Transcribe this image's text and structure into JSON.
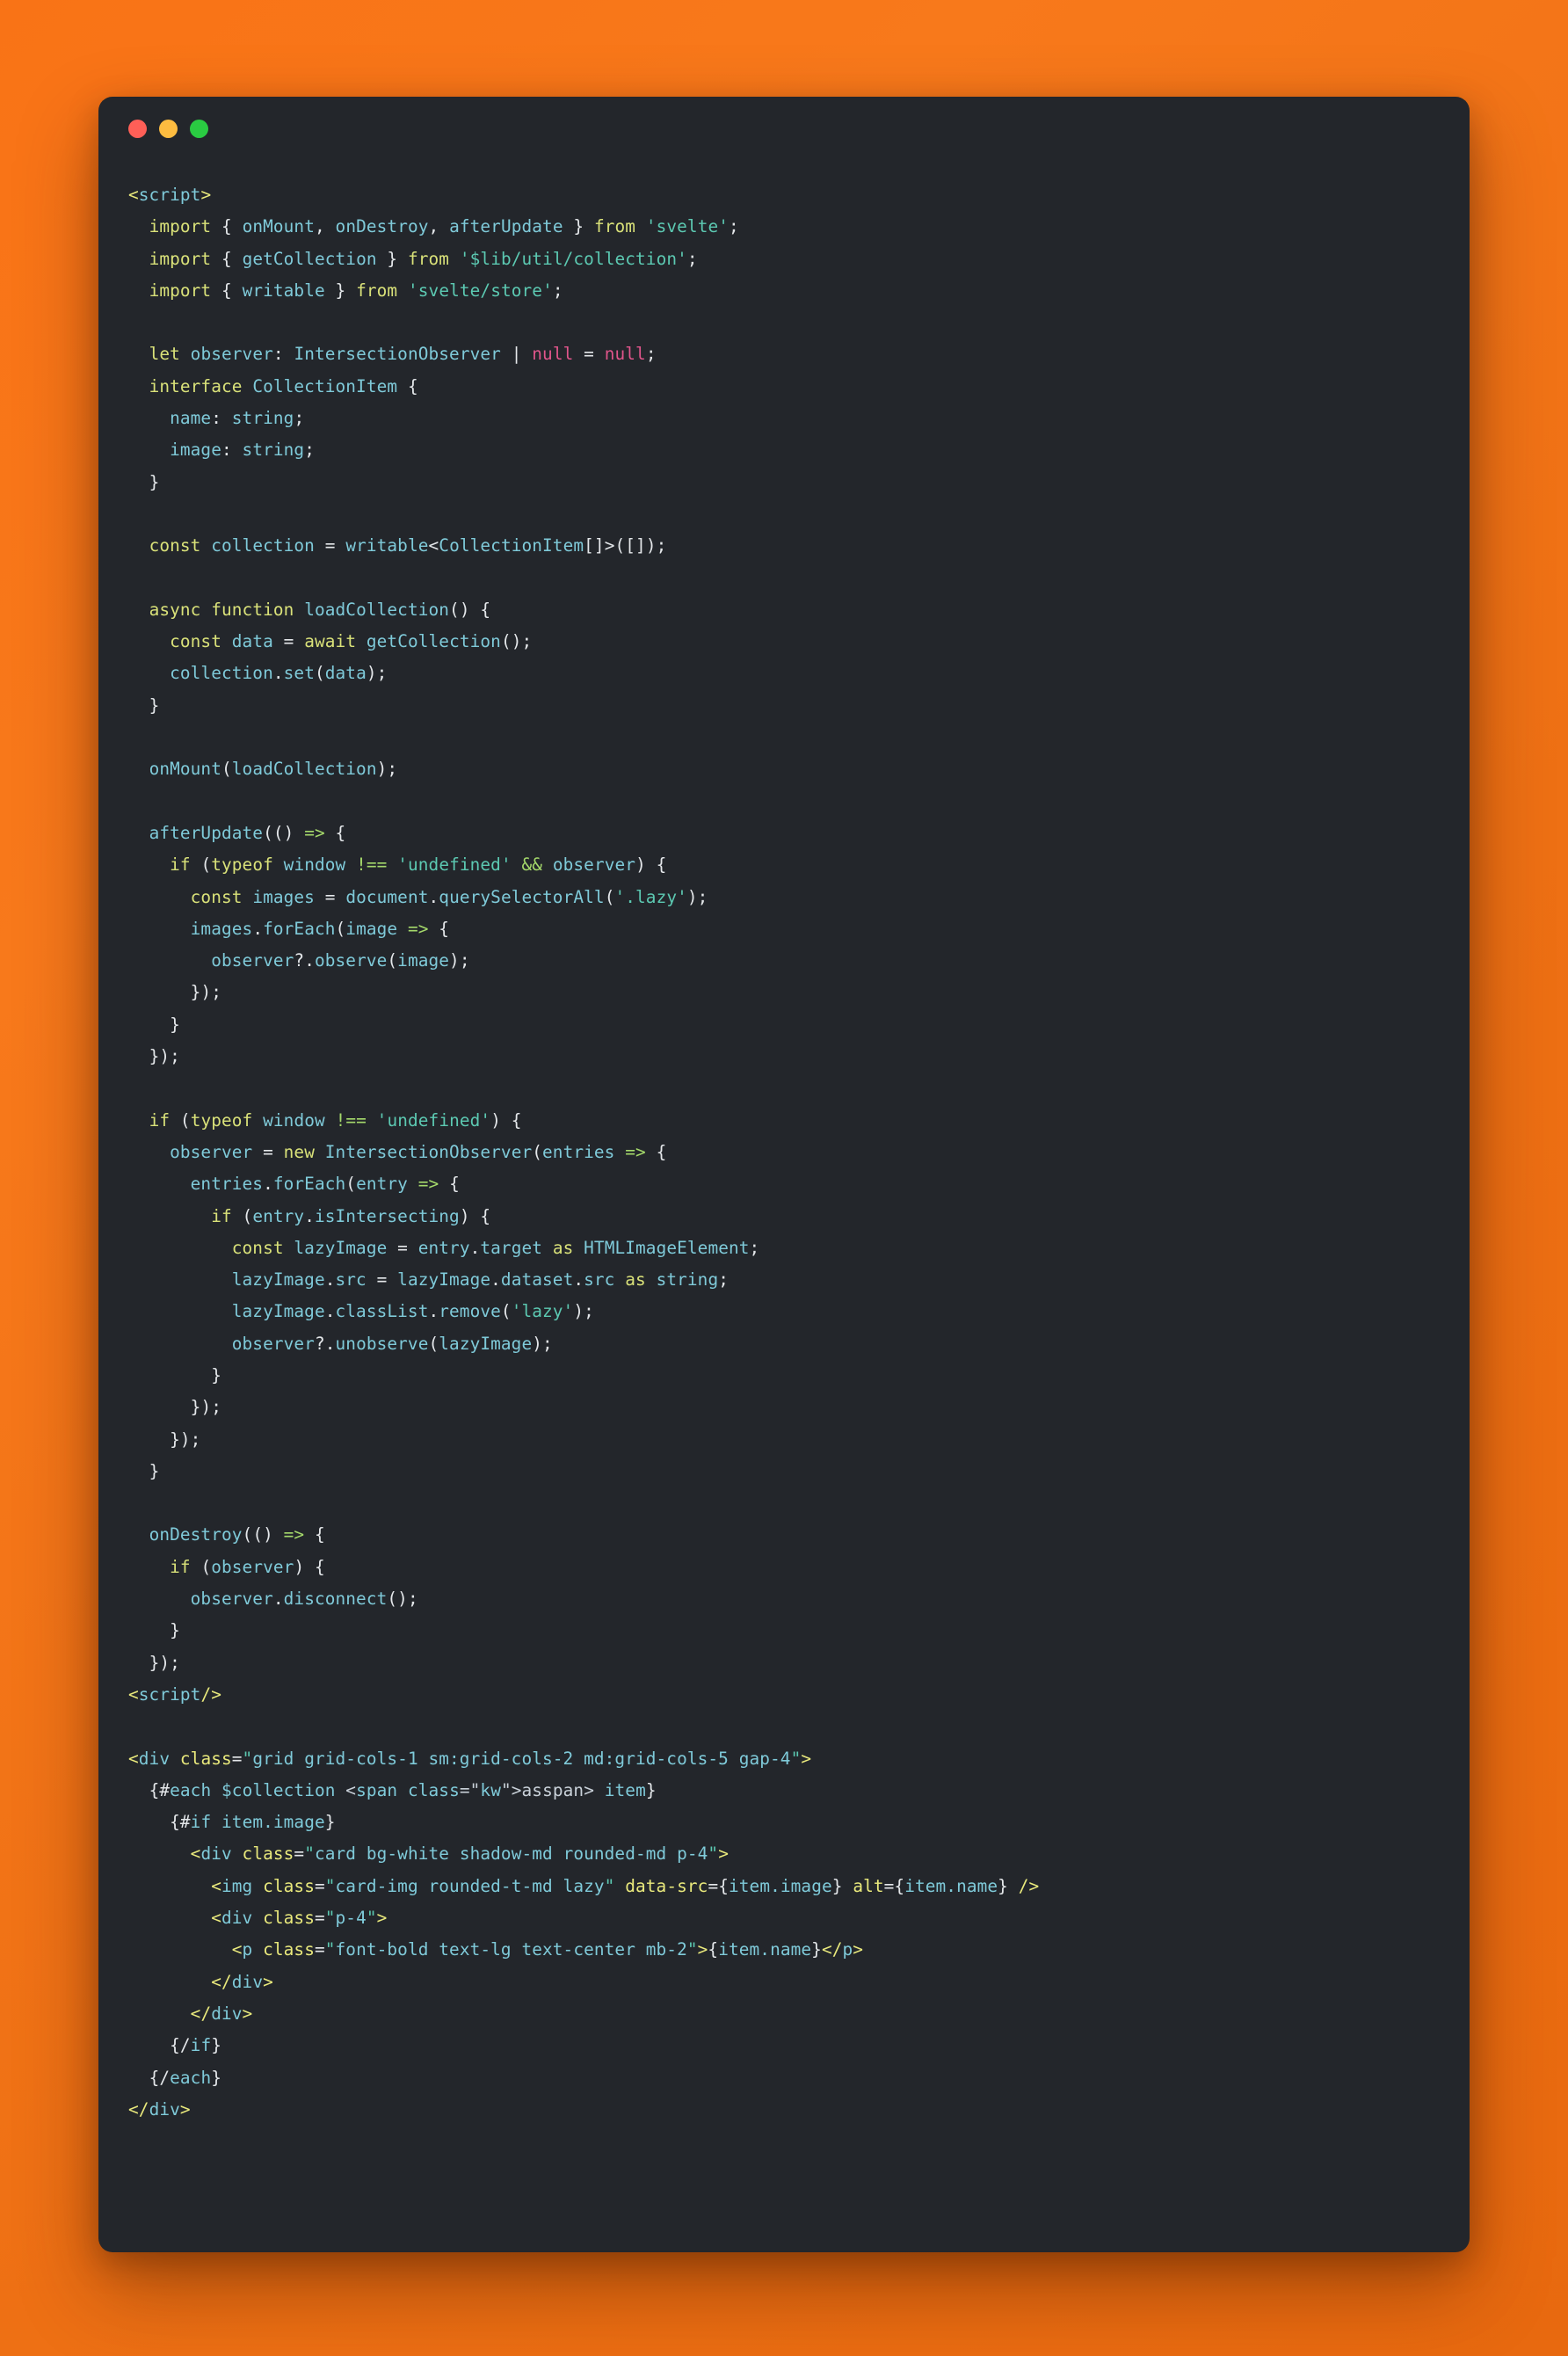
{
  "window": {
    "background_color": "#F97316",
    "panel_color": "#23262B",
    "traffic_lights": [
      {
        "name": "close",
        "color": "#FF5F57"
      },
      {
        "name": "minimize",
        "color": "#FDBC40"
      },
      {
        "name": "maximize",
        "color": "#2ACB42"
      }
    ]
  },
  "theme": {
    "keyword": "#D9E179",
    "identifier": "#7FCAD9",
    "string": "#5CC9B2",
    "tag": "#E9E97C",
    "punctuation": "#E4E7EA",
    "null_literal": "#E0558B",
    "operator": "#A5D96B"
  },
  "code": {
    "language": "svelte",
    "lines": [
      "<script>",
      "  import { onMount, onDestroy, afterUpdate } from 'svelte';",
      "  import { getCollection } from '$lib/util/collection';",
      "  import { writable } from 'svelte/store';",
      "",
      "  let observer: IntersectionObserver | null = null;",
      "  interface CollectionItem {",
      "    name: string;",
      "    image: string;",
      "  }",
      "",
      "  const collection = writable<CollectionItem[]>([]);",
      "",
      "  async function loadCollection() {",
      "    const data = await getCollection();",
      "    collection.set(data);",
      "  }",
      "",
      "  onMount(loadCollection);",
      "",
      "  afterUpdate(() => {",
      "    if (typeof window !== 'undefined' && observer) {",
      "      const images = document.querySelectorAll('.lazy');",
      "      images.forEach(image => {",
      "        observer?.observe(image);",
      "      });",
      "    }",
      "  });",
      "",
      "  if (typeof window !== 'undefined') {",
      "    observer = new IntersectionObserver(entries => {",
      "      entries.forEach(entry => {",
      "        if (entry.isIntersecting) {",
      "          const lazyImage = entry.target as HTMLImageElement;",
      "          lazyImage.src = lazyImage.dataset.src as string;",
      "          lazyImage.classList.remove('lazy');",
      "          observer?.unobserve(lazyImage);",
      "        }",
      "      });",
      "    });",
      "  }",
      "",
      "  onDestroy(() => {",
      "    if (observer) {",
      "      observer.disconnect();",
      "    }",
      "  });",
      "<script/>",
      "",
      "<div class=\"grid grid-cols-1 sm:grid-cols-2 md:grid-cols-5 gap-4\">",
      "  {#each $collection as item}",
      "    {#if item.image}",
      "      <div class=\"card bg-white shadow-md rounded-md p-4\">",
      "        <img class=\"card-img rounded-t-md lazy\" data-src={item.image} alt={item.name} />",
      "        <div class=\"p-4\">",
      "          <p class=\"font-bold text-lg text-center mb-2\">{item.name}</p>",
      "        </div>",
      "      </div>",
      "    {/if}",
      "  {/each}",
      "</div>"
    ]
  }
}
